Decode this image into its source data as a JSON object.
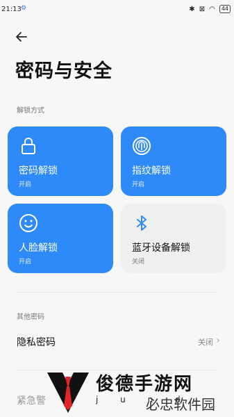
{
  "status": {
    "time": "21:13",
    "battery": "44"
  },
  "header": {
    "title": "密码与安全"
  },
  "unlock": {
    "section": "解锁方式",
    "cards": [
      {
        "name": "密码解锁",
        "state": "开启"
      },
      {
        "name": "指纹解锁",
        "state": "开启"
      },
      {
        "name": "人脸解锁",
        "state": "开启"
      },
      {
        "name": "蓝牙设备解锁",
        "state": "关闭"
      }
    ]
  },
  "other": {
    "section": "其他密码",
    "privacy_label": "隐私密码",
    "privacy_value": "关闭",
    "emergency_label": "紧急警"
  },
  "watermark": {
    "title": "俊德手游网",
    "sub": "j u n d",
    "small": "必忠软件园"
  },
  "colors": {
    "accent": "#2d8af8",
    "background": "#f7f7f7"
  }
}
